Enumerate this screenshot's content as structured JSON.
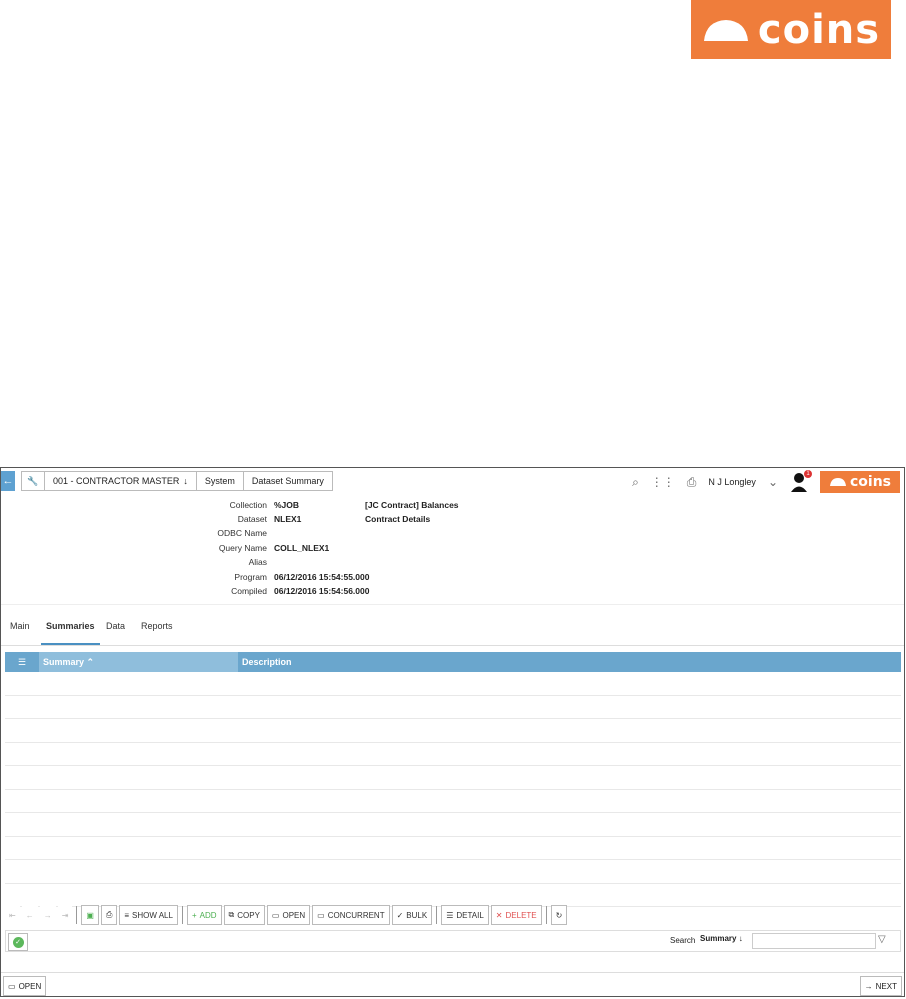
{
  "brand": {
    "logo_text": "coins",
    "color": "#ef7d3b"
  },
  "breadcrumbs": [
    "001 - CONTRACTOR MASTER",
    "System",
    "Dataset Summary"
  ],
  "header": {
    "user": "N J Longley",
    "notification_count": "1"
  },
  "info": [
    {
      "label": "Collection",
      "value": "%JOB",
      "extra": "[JC Contract] Balances"
    },
    {
      "label": "Dataset",
      "value": "NLEX1",
      "extra": "Contract Details"
    },
    {
      "label": "ODBC Name",
      "value": "",
      "extra": ""
    },
    {
      "label": "Query Name",
      "value": "COLL_NLEX1",
      "extra": ""
    },
    {
      "label": "Alias",
      "value": "",
      "extra": ""
    },
    {
      "label": "Program",
      "value": "06/12/2016 15:54:55.000",
      "extra": ""
    },
    {
      "label": "Compiled",
      "value": "06/12/2016 15:54:56.000",
      "extra": ""
    }
  ],
  "tabs": [
    "Main",
    "Summaries",
    "Data",
    "Reports"
  ],
  "active_tab": "Summaries",
  "grid": {
    "col_summary": "Summary",
    "col_description": "Description",
    "rows": 10
  },
  "toolbar": {
    "show_all": "SHOW ALL",
    "add": "ADD",
    "copy": "COPY",
    "open": "OPEN",
    "concurrent": "CONCURRENT",
    "bulk": "BULK",
    "detail": "DETAIL",
    "delete": "DELETE"
  },
  "search": {
    "label": "Search",
    "field": "Summary"
  },
  "bottom": {
    "open": "OPEN",
    "next": "NEXT"
  }
}
